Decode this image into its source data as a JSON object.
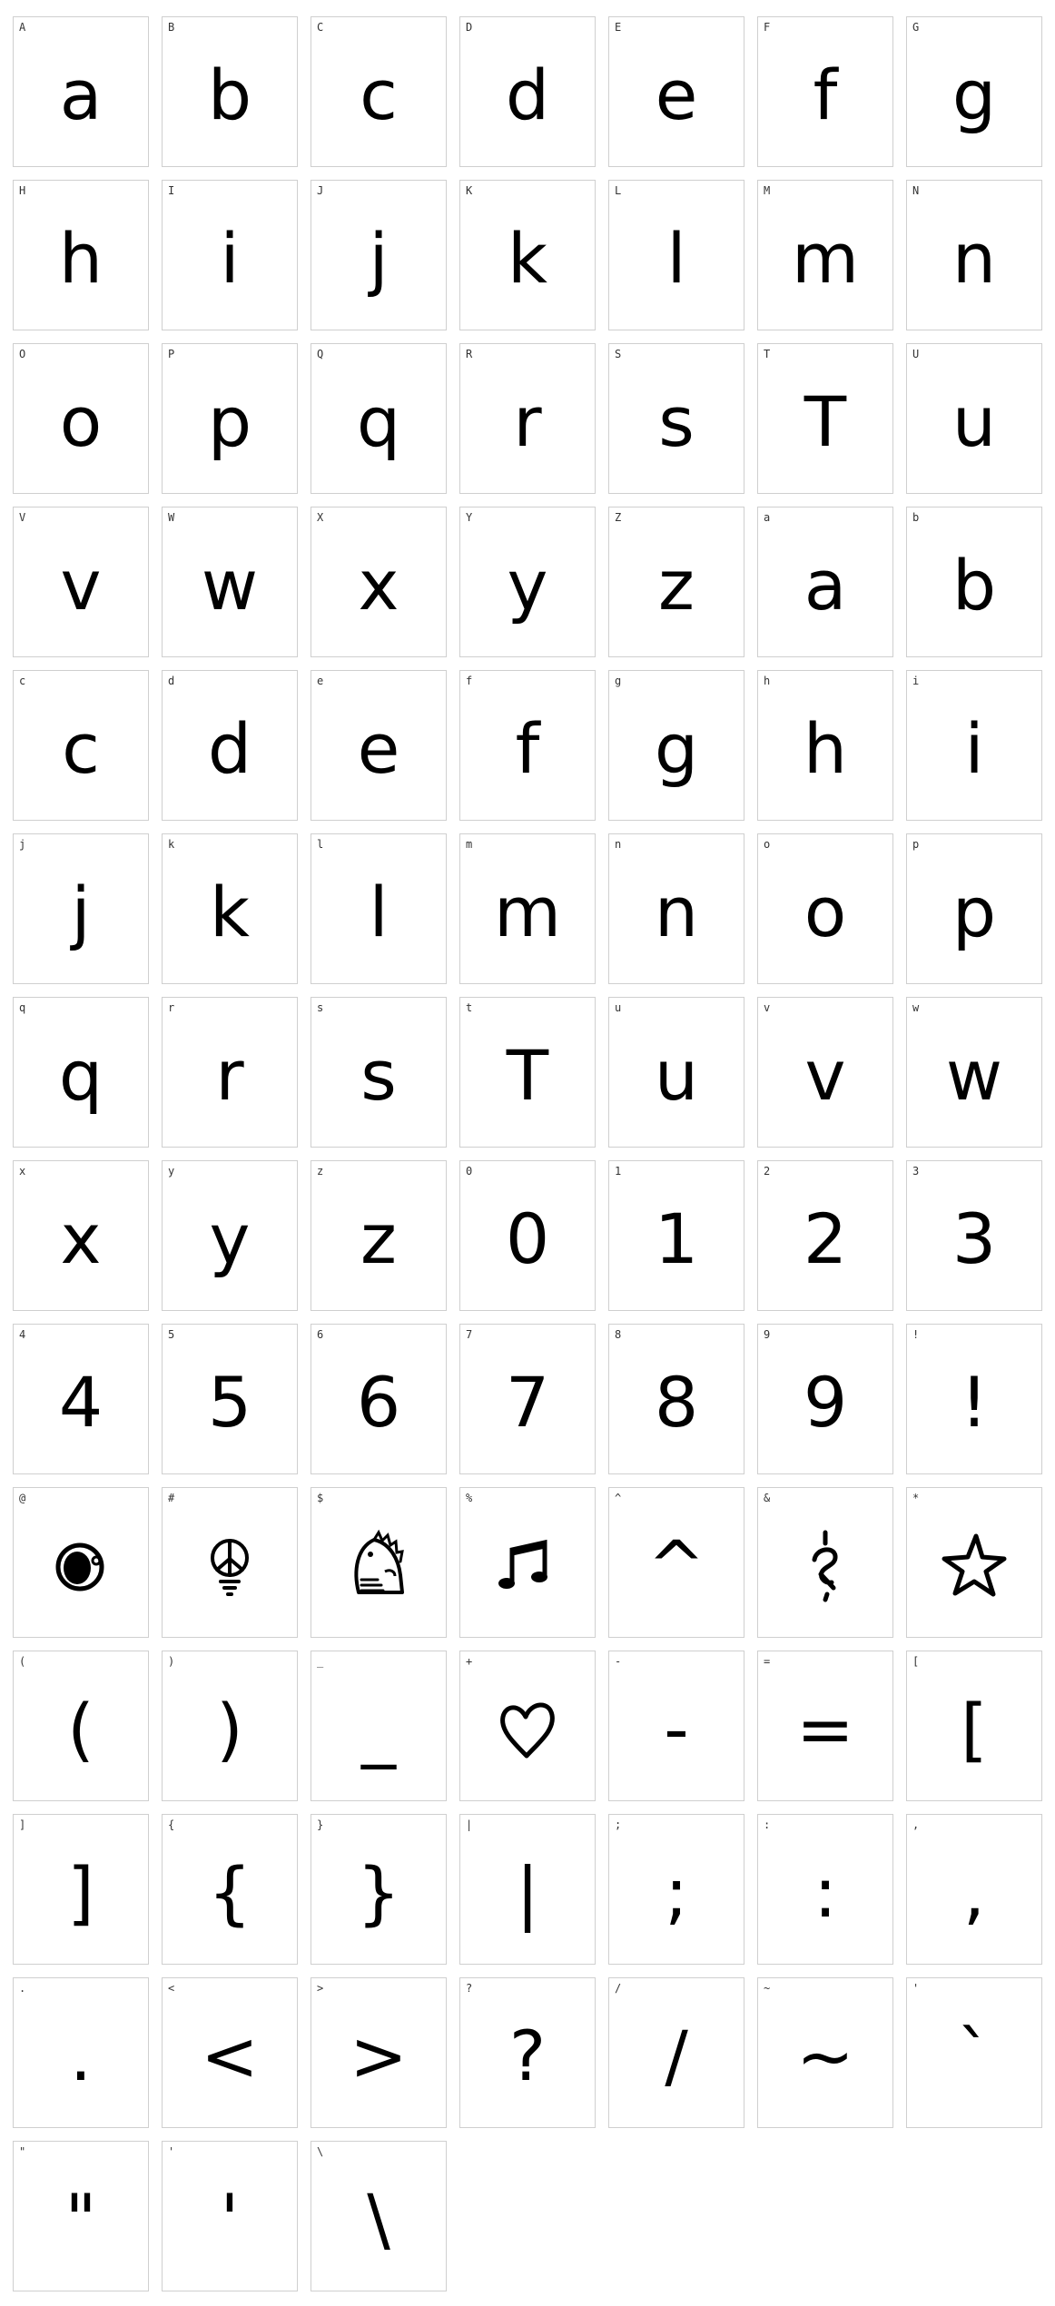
{
  "glyph_chart": {
    "cells": [
      {
        "label": "A",
        "glyph": "a"
      },
      {
        "label": "B",
        "glyph": "b"
      },
      {
        "label": "C",
        "glyph": "c"
      },
      {
        "label": "D",
        "glyph": "d"
      },
      {
        "label": "E",
        "glyph": "e"
      },
      {
        "label": "F",
        "glyph": "f"
      },
      {
        "label": "G",
        "glyph": "g"
      },
      {
        "label": "H",
        "glyph": "h"
      },
      {
        "label": "I",
        "glyph": "i"
      },
      {
        "label": "J",
        "glyph": "j"
      },
      {
        "label": "K",
        "glyph": "k"
      },
      {
        "label": "L",
        "glyph": "l"
      },
      {
        "label": "M",
        "glyph": "m"
      },
      {
        "label": "N",
        "glyph": "n"
      },
      {
        "label": "O",
        "glyph": "o"
      },
      {
        "label": "P",
        "glyph": "p"
      },
      {
        "label": "Q",
        "glyph": "q"
      },
      {
        "label": "R",
        "glyph": "r"
      },
      {
        "label": "S",
        "glyph": "s"
      },
      {
        "label": "T",
        "glyph": "T"
      },
      {
        "label": "U",
        "glyph": "u"
      },
      {
        "label": "V",
        "glyph": "v"
      },
      {
        "label": "W",
        "glyph": "w"
      },
      {
        "label": "X",
        "glyph": "x"
      },
      {
        "label": "Y",
        "glyph": "y"
      },
      {
        "label": "Z",
        "glyph": "z"
      },
      {
        "label": "a",
        "glyph": "a"
      },
      {
        "label": "b",
        "glyph": "b"
      },
      {
        "label": "c",
        "glyph": "c"
      },
      {
        "label": "d",
        "glyph": "d"
      },
      {
        "label": "e",
        "glyph": "e"
      },
      {
        "label": "f",
        "glyph": "f"
      },
      {
        "label": "g",
        "glyph": "g"
      },
      {
        "label": "h",
        "glyph": "h"
      },
      {
        "label": "i",
        "glyph": "i"
      },
      {
        "label": "j",
        "glyph": "j"
      },
      {
        "label": "k",
        "glyph": "k"
      },
      {
        "label": "l",
        "glyph": "l"
      },
      {
        "label": "m",
        "glyph": "m"
      },
      {
        "label": "n",
        "glyph": "n"
      },
      {
        "label": "o",
        "glyph": "o"
      },
      {
        "label": "p",
        "glyph": "p"
      },
      {
        "label": "q",
        "glyph": "q"
      },
      {
        "label": "r",
        "glyph": "r"
      },
      {
        "label": "s",
        "glyph": "s"
      },
      {
        "label": "t",
        "glyph": "T"
      },
      {
        "label": "u",
        "glyph": "u"
      },
      {
        "label": "v",
        "glyph": "v"
      },
      {
        "label": "w",
        "glyph": "w"
      },
      {
        "label": "x",
        "glyph": "x"
      },
      {
        "label": "y",
        "glyph": "y"
      },
      {
        "label": "z",
        "glyph": "z"
      },
      {
        "label": "0",
        "glyph": "0"
      },
      {
        "label": "1",
        "glyph": "1"
      },
      {
        "label": "2",
        "glyph": "2"
      },
      {
        "label": "3",
        "glyph": "3"
      },
      {
        "label": "4",
        "glyph": "4"
      },
      {
        "label": "5",
        "glyph": "5"
      },
      {
        "label": "6",
        "glyph": "6"
      },
      {
        "label": "7",
        "glyph": "7"
      },
      {
        "label": "8",
        "glyph": "8"
      },
      {
        "label": "9",
        "glyph": "9"
      },
      {
        "label": "!",
        "glyph": "!"
      },
      {
        "label": "@",
        "icon": "donut-icon"
      },
      {
        "label": "#",
        "icon": "peace-sign-icon"
      },
      {
        "label": "$",
        "icon": "dinosaur-icon"
      },
      {
        "label": "%",
        "icon": "music-note-icon"
      },
      {
        "label": "^",
        "glyph": "^"
      },
      {
        "label": "&",
        "icon": "ampersand-doodle-icon"
      },
      {
        "label": "*",
        "icon": "star-icon"
      },
      {
        "label": "(",
        "glyph": "("
      },
      {
        "label": ")",
        "glyph": ")"
      },
      {
        "label": "_",
        "glyph": "_"
      },
      {
        "label": "+",
        "icon": "heart-icon"
      },
      {
        "label": "-",
        "glyph": "-"
      },
      {
        "label": "=",
        "glyph": "="
      },
      {
        "label": "[",
        "glyph": "["
      },
      {
        "label": "]",
        "glyph": "]"
      },
      {
        "label": "{",
        "glyph": "{"
      },
      {
        "label": "}",
        "glyph": "}"
      },
      {
        "label": "|",
        "glyph": "|"
      },
      {
        "label": ";",
        "glyph": ";"
      },
      {
        "label": ":",
        "glyph": ":"
      },
      {
        "label": ",",
        "glyph": ","
      },
      {
        "label": ".",
        "glyph": "."
      },
      {
        "label": "<",
        "glyph": "<"
      },
      {
        "label": ">",
        "glyph": ">"
      },
      {
        "label": "?",
        "glyph": "?"
      },
      {
        "label": "/",
        "glyph": "/"
      },
      {
        "label": "~",
        "glyph": "~"
      },
      {
        "label": "'",
        "glyph": "`"
      },
      {
        "label": "\"",
        "glyph": "\""
      },
      {
        "label": "'",
        "glyph": "'"
      },
      {
        "label": "\\",
        "glyph": "\\"
      }
    ]
  }
}
